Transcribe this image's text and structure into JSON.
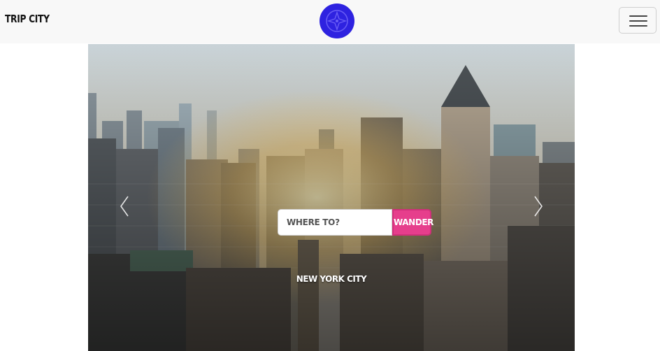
{
  "navbar": {
    "brand": "TRIP CITY",
    "logo_icon": "compass-logo-icon",
    "logo_color": "#2e22e0",
    "menu_icon": "hamburger-menu-icon"
  },
  "carousel": {
    "prev_icon": "chevron-left-icon",
    "next_icon": "chevron-right-icon",
    "slide_caption": "NEW YORK CITY",
    "search": {
      "placeholder": "WHERE TO?",
      "button_label": "WANDER"
    },
    "accent_color": "#e63e8c"
  }
}
